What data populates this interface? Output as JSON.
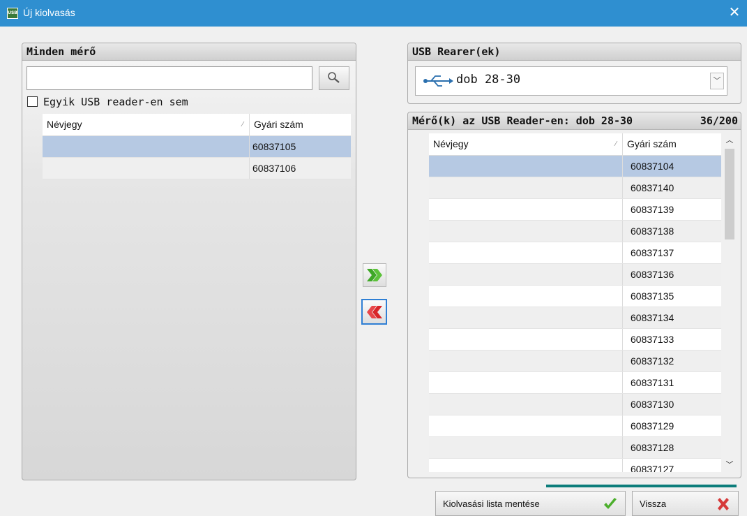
{
  "window": {
    "title": "Új kiolvasás",
    "icon_text": "USB",
    "close_glyph": "✕"
  },
  "left_panel": {
    "header": "Minden mérő",
    "search": {
      "value": "",
      "placeholder": ""
    },
    "checkbox_label": "Egyik USB reader-en sem",
    "checkbox_checked": false,
    "columns": [
      "Névjegy",
      "Gyári szám"
    ],
    "rows": [
      {
        "name": "",
        "serial": "60837105",
        "selected": true
      },
      {
        "name": "",
        "serial": "60837106",
        "selected": false
      }
    ]
  },
  "reader_panel": {
    "header": "USB Rearer(ek)",
    "selected_reader": "dob 28-30"
  },
  "usb_meters_panel": {
    "header": "Mérő(k) az USB Reader-en: dob 28-30",
    "count": "36/200",
    "columns": [
      "Névjegy",
      "Gyári szám"
    ],
    "rows": [
      {
        "name": "",
        "serial": "60837104",
        "selected": true
      },
      {
        "name": "",
        "serial": "60837140"
      },
      {
        "name": "",
        "serial": "60837139"
      },
      {
        "name": "",
        "serial": "60837138"
      },
      {
        "name": "",
        "serial": "60837137"
      },
      {
        "name": "",
        "serial": "60837136"
      },
      {
        "name": "",
        "serial": "60837135"
      },
      {
        "name": "",
        "serial": "60837134"
      },
      {
        "name": "",
        "serial": "60837133"
      },
      {
        "name": "",
        "serial": "60837132"
      },
      {
        "name": "",
        "serial": "60837131"
      },
      {
        "name": "",
        "serial": "60837130"
      },
      {
        "name": "",
        "serial": "60837129"
      },
      {
        "name": "",
        "serial": "60837128"
      },
      {
        "name": "",
        "serial": "60837127"
      }
    ]
  },
  "actions": {
    "save_label": "Kiolvasási lista mentése",
    "back_label": "Vissza"
  },
  "colors": {
    "titlebar": "#2f8fd0",
    "selection": "#b6c9e3",
    "add_arrow": "#3fa827",
    "remove_arrow": "#d8262a",
    "progress": "#0c7d7b"
  }
}
